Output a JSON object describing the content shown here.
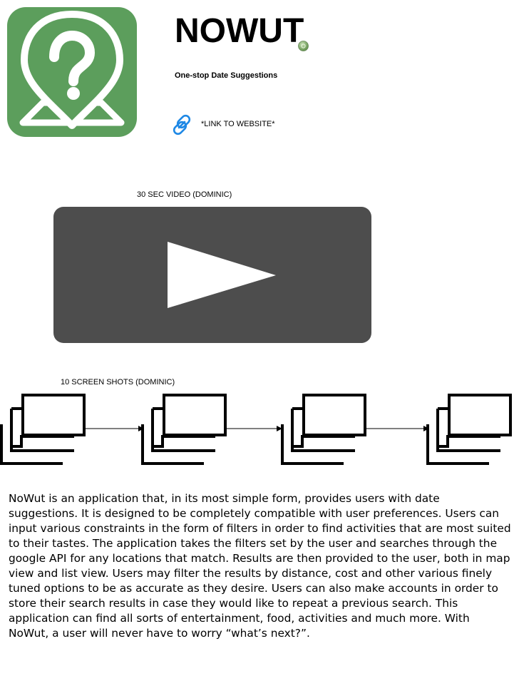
{
  "header": {
    "title": "NOWUT",
    "subtitle": "One-stop Date Suggestions",
    "link_label": "*LINK TO WEBSITE*",
    "logo_icon": "map-pin-question-icon",
    "link_icon": "link-chain-icon",
    "brand_color": "#5c9e5c",
    "link_color": "#1e88e5"
  },
  "video": {
    "label": "30 SEC VIDEO (DOMINIC)",
    "icon": "play-icon",
    "background_color": "#4d4d4d"
  },
  "screenshots": {
    "label": "10 SCREEN SHOTS (DOMINIC)",
    "icon": "stacked-screens-icon",
    "count_shown": 4
  },
  "description": "NoWut is an application that, in its most simple form, provides users with date suggestions.  It is designed to be completely compatible with user preferences. Users can input various constraints in the form of filters in order to find activities that are most suited to their tastes.  The application takes the filters set by the user and searches through the google API for any locations that match. Results are then provided to the user, both in map view and list view. Users may filter the results by distance, cost and other various finely tuned options to be as accurate as they desire.  Users can also make accounts in order to store their search results in case they would like to repeat a previous search. This application can find all sorts of entertainment, food, activities and much more. With NoWut, a user will never have to worry “what’s next?”."
}
